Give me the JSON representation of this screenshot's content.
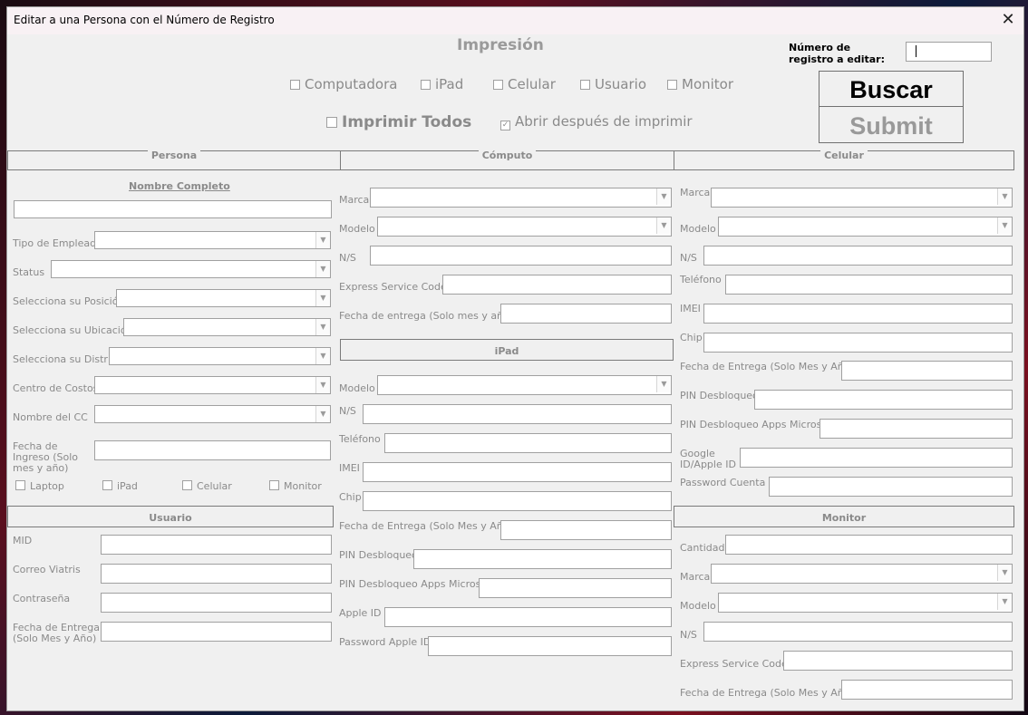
{
  "window": {
    "title": "Editar a una Persona con el Número de Registro"
  },
  "header": {
    "impresion_title": "Impresión",
    "print_checks": [
      "Computadora",
      "iPad",
      "Celular",
      "Usuario",
      "Monitor"
    ],
    "print_all": "Imprimir Todos",
    "open_after": "Abrir después de imprimir",
    "open_after_checked": true,
    "registro_label": "Número de registro a editar:",
    "buscar": "Buscar",
    "submit": "Submit"
  },
  "persona": {
    "title": "Persona",
    "nombre_completo": "Nombre Completo",
    "tipo_empleado": "Tipo de Empleado",
    "status": "Status",
    "posicion": "Selecciona su Posición",
    "ubicacion": "Selecciona su Ubicación",
    "distrito": "Selecciona su Distrito",
    "centro_costos": "Centro de Costos",
    "nombre_cc": "Nombre del CC",
    "fecha_ingreso": "Fecha de Ingreso (Solo mes y año)",
    "checks": [
      "Laptop",
      "iPad",
      "Celular",
      "Monitor"
    ]
  },
  "usuario": {
    "title": "Usuario",
    "mid": "MID",
    "correo": "Correo Viatris",
    "contrasena": "Contraseña",
    "fecha_entrega": "Fecha de Entrega (Solo Mes y Año)"
  },
  "computo": {
    "title": "Cómputo",
    "marca": "Marca",
    "modelo": "Modelo",
    "ns": "N/S",
    "express": "Express Service Code",
    "fecha_entrega": "Fecha de entrega (Solo mes y año)"
  },
  "ipad": {
    "title": "iPad",
    "modelo": "Modelo",
    "ns": "N/S",
    "telefono": "Teléfono",
    "imei": "IMEI",
    "chip": "Chip",
    "fecha_entrega": "Fecha de Entrega (Solo Mes y Año)",
    "pin": "PIN Desbloqueo",
    "pin_apps": "PIN Desbloqueo Apps Microsoft",
    "apple_id": "Apple ID",
    "password_apple": "Password Apple ID"
  },
  "celular": {
    "title": "Celular",
    "marca": "Marca",
    "modelo": "Modelo",
    "ns": "N/S",
    "telefono": "Teléfono",
    "imei": "IMEI",
    "chip": "Chip",
    "fecha_entrega": "Fecha de Entrega (Solo Mes y Año)",
    "pin": "PIN Desbloqueo",
    "pin_apps": "PIN Desbloqueo Apps Microsoft",
    "google_id": "Google ID/Apple ID",
    "password_cuenta": "Password Cuenta"
  },
  "monitor": {
    "title": "Monitor",
    "cantidad": "Cantidad",
    "marca": "Marca",
    "modelo": "Modelo",
    "ns": "N/S",
    "express": "Express Service Code",
    "fecha_entrega": "Fecha de Entrega (Solo Mes y Año)"
  },
  "icons": {
    "close": "close-icon",
    "dropdown": "chevron-down-icon",
    "check": "checkmark-icon"
  },
  "colors": {
    "window_bg": "#f0f0f0",
    "label_gray": "#8a8a8a",
    "titlebar": "#f8f1f4"
  }
}
